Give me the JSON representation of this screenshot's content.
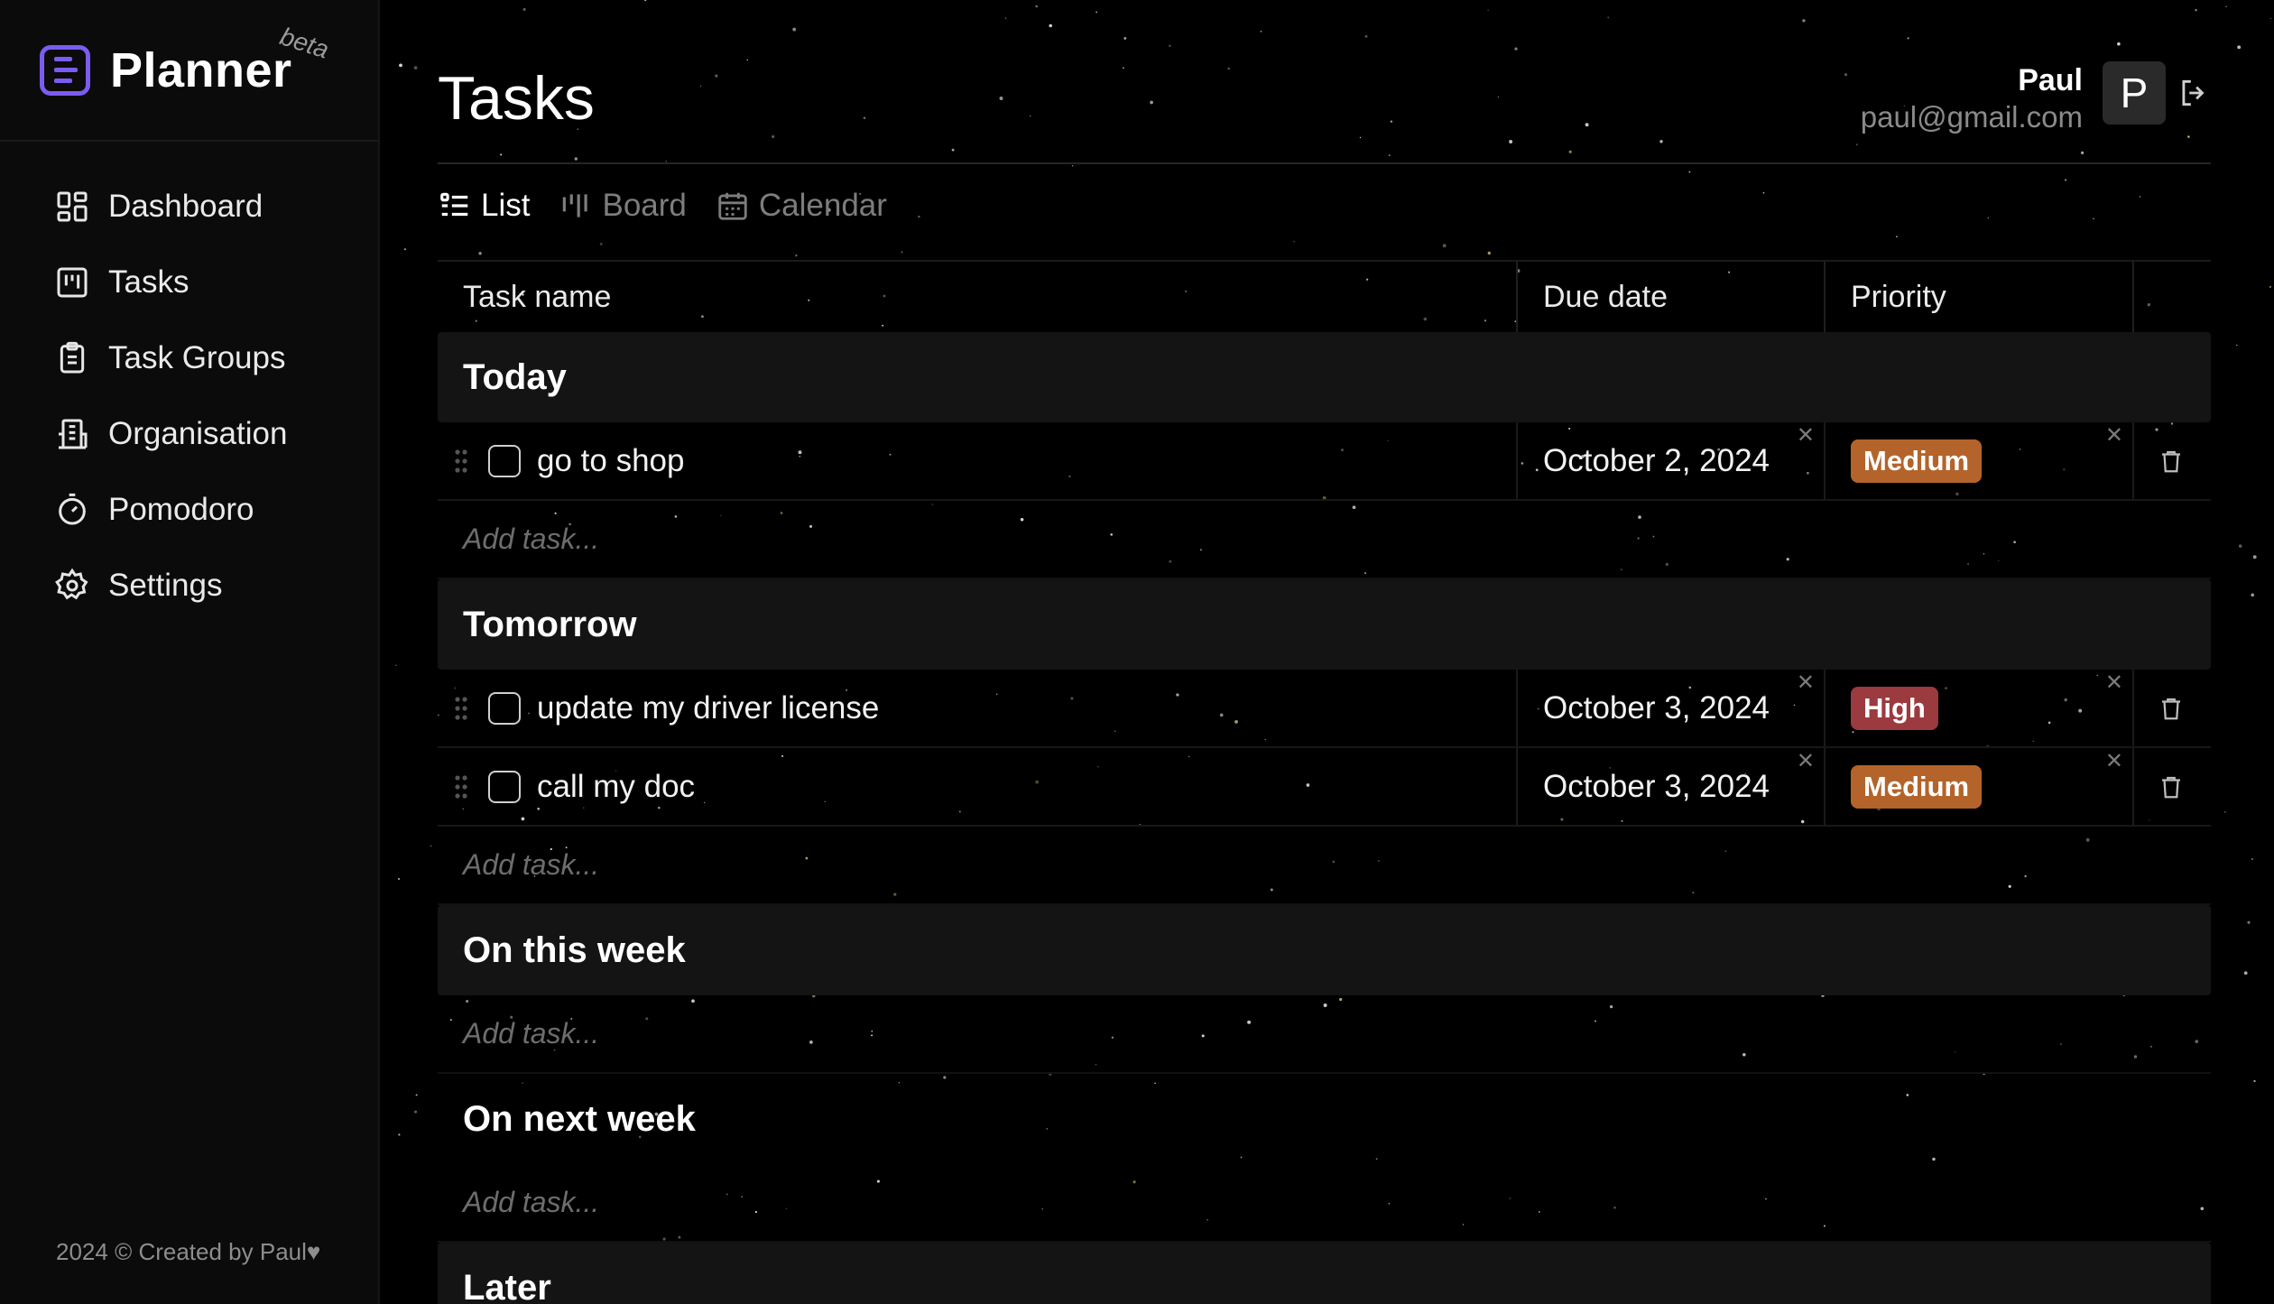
{
  "app": {
    "name": "Planner",
    "badge": "beta",
    "footer": "2024 © Created by Paul♥"
  },
  "sidebar": {
    "items": [
      {
        "label": "Dashboard",
        "icon": "dashboard-icon"
      },
      {
        "label": "Tasks",
        "icon": "kanban-icon"
      },
      {
        "label": "Task Groups",
        "icon": "clipboard-list-icon"
      },
      {
        "label": "Organisation",
        "icon": "building-icon"
      },
      {
        "label": "Pomodoro",
        "icon": "timer-icon"
      },
      {
        "label": "Settings",
        "icon": "gear-icon"
      }
    ]
  },
  "header": {
    "title": "Tasks",
    "user": {
      "name": "Paul",
      "email": "paul@gmail.com",
      "avatar_letter": "P"
    }
  },
  "views": [
    {
      "label": "List",
      "icon": "list-icon",
      "active": true
    },
    {
      "label": "Board",
      "icon": "board-icon",
      "active": false
    },
    {
      "label": "Calendar",
      "icon": "calendar-icon",
      "active": false
    }
  ],
  "table": {
    "columns": [
      "Task name",
      "Due date",
      "Priority"
    ],
    "add_placeholder": "Add task...",
    "groups": [
      {
        "title": "Today",
        "tasks": [
          {
            "name": "go to shop",
            "due": "October 2, 2024",
            "priority": "Medium"
          }
        ]
      },
      {
        "title": "Tomorrow",
        "tasks": [
          {
            "name": "update my driver license",
            "due": "October 3, 2024",
            "priority": "High"
          },
          {
            "name": "call my doc",
            "due": "October 3, 2024",
            "priority": "Medium"
          }
        ]
      },
      {
        "title": "On this week",
        "tasks": []
      },
      {
        "title": "On next week",
        "tasks": []
      },
      {
        "title": "Later",
        "tasks": []
      }
    ]
  },
  "colors": {
    "accent": "#7b5cf0",
    "priority_medium": "#b4642a",
    "priority_high": "#9b3a3f"
  }
}
